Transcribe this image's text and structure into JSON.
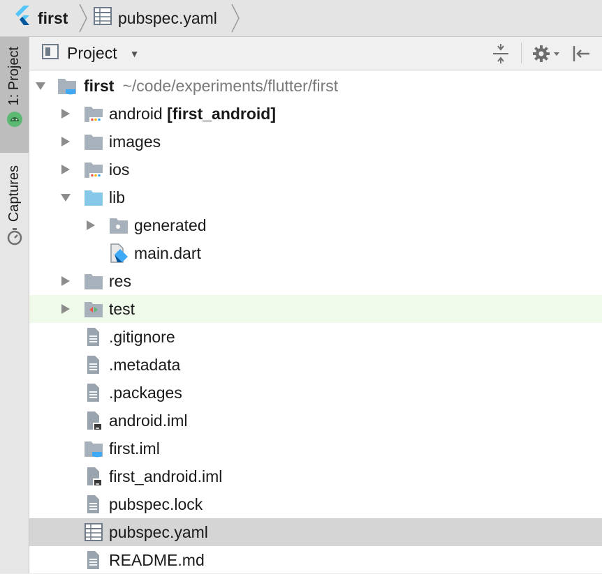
{
  "breadcrumb": {
    "project": "first",
    "file": "pubspec.yaml"
  },
  "side_tabs": {
    "project": "1: Project",
    "captures": "Captures"
  },
  "panel": {
    "title": "Project",
    "icons": [
      "collapse-all-icon",
      "gear-icon",
      "hide-panel-icon"
    ]
  },
  "tree": {
    "root": {
      "name": "first",
      "path": "~/code/experiments/flutter/first",
      "expanded": true
    },
    "items": {
      "android": {
        "name": "android",
        "module": "[first_android]"
      },
      "images": {
        "name": "images"
      },
      "ios": {
        "name": "ios"
      },
      "lib": {
        "name": "lib",
        "expanded": true
      },
      "generated": {
        "name": "generated"
      },
      "main_dart": {
        "name": "main.dart"
      },
      "res": {
        "name": "res"
      },
      "test": {
        "name": "test"
      },
      "gitignore": {
        "name": ".gitignore"
      },
      "metadata": {
        "name": ".metadata"
      },
      "packages": {
        "name": ".packages"
      },
      "android_iml": {
        "name": "android.iml"
      },
      "first_iml": {
        "name": "first.iml"
      },
      "first_android_iml": {
        "name": "first_android.iml"
      },
      "pubspec_lock": {
        "name": "pubspec.lock"
      },
      "pubspec_yaml": {
        "name": "pubspec.yaml",
        "selected": true
      },
      "readme": {
        "name": "README.md"
      }
    }
  },
  "colors": {
    "folder": "#a7b1bc",
    "source_folder": "#87c7e8",
    "flutter_blue": "#3fa9f5",
    "selected_row": "#d5d5d5",
    "test_row": "#effaea"
  }
}
